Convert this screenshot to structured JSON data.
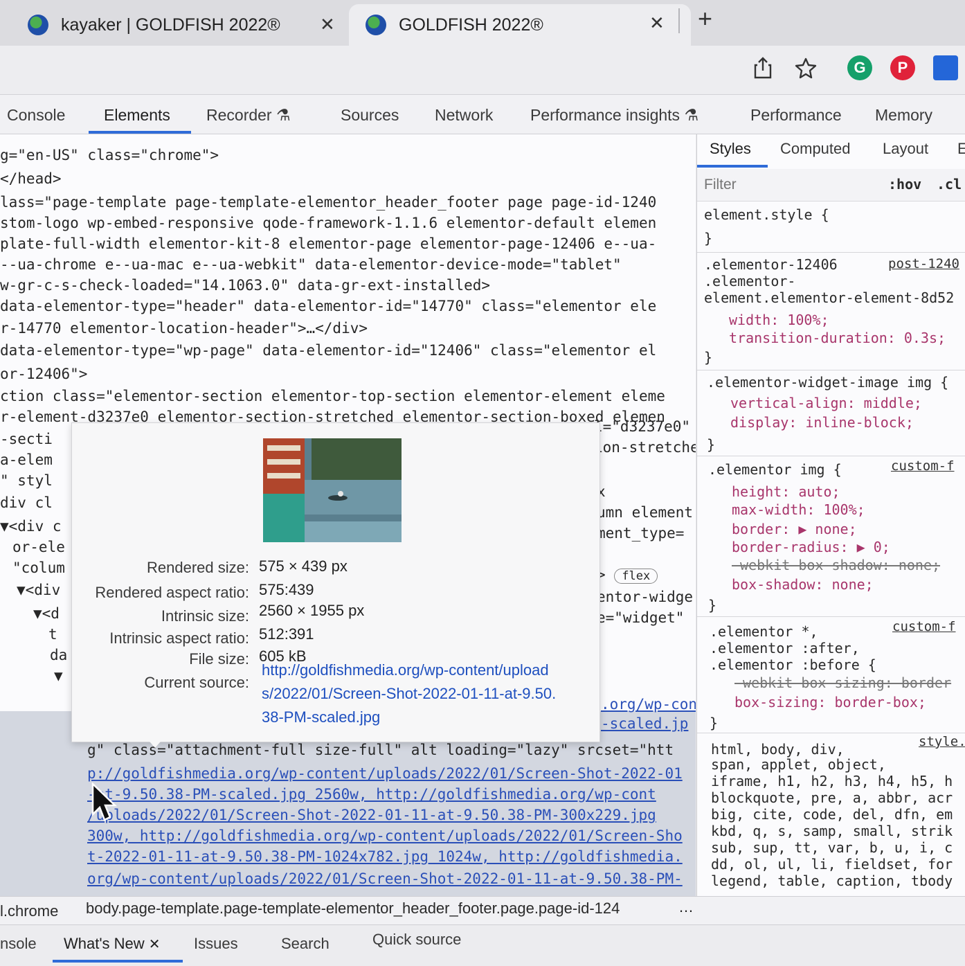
{
  "browser": {
    "tabs": [
      {
        "title": "kayaker | GOLDFISH 2022®",
        "close": "✕"
      },
      {
        "title": "GOLDFISH 2022®",
        "close": "✕"
      }
    ],
    "new_tab": "+"
  },
  "devtools": {
    "tabs": [
      "Console",
      "Elements",
      "Recorder",
      "Sources",
      "Network",
      "Performance insights",
      "Performance",
      "Memory"
    ],
    "dom_lines": [
      "g=\"en-US\" class=\"chrome\">",
      "</head>",
      "lass=\"page-template page-template-elementor_header_footer page page-id-1240",
      "stom-logo wp-embed-responsive qode-framework-1.1.6 elementor-default elemen",
      "plate-full-width elementor-kit-8 elementor-page elementor-page-12406 e--ua-",
      "--ua-chrome e--ua-mac e--ua-webkit\" data-elementor-device-mode=\"tablet\"",
      "w-gr-c-s-check-loaded=\"14.1063.0\" data-gr-ext-installed>",
      "data-elementor-type=\"header\" data-elementor-id=\"14770\" class=\"elementor ele",
      "r-14770 elementor-location-header\">…</div>",
      "data-elementor-type=\"wp-page\" data-elementor-id=\"12406\" class=\"elementor el",
      "or-12406\">",
      "ction class=\"elementor-section elementor-top-section elementor-element eleme",
      "r-element-d3237e0 elementor-section-stretched elementor-section-boxed elemen"
    ],
    "dom_left_frags": [
      "-secti",
      "a-elem",
      "\" styl",
      "div cl",
      "▼<div c",
      "or-ele",
      "\"colum",
      "▼<div",
      "▼<d",
      "t",
      "da",
      "▼"
    ],
    "dom_right_frags": [
      "l=\"d3237e0\"",
      "ion-stretche",
      "x",
      "umn element",
      "ment_type=",
      ">",
      "flex",
      "entor-widge",
      "e=\"widget\"",
      ".org/wp-con",
      "-scaled.jp"
    ],
    "sel_lines": [
      "g\" class=\"attachment-full size-full\" alt loading=\"lazy\" srcset=\"htt",
      "p://goldfishmedia.org/wp-content/uploads/2022/01/Screen-Shot-2022-01",
      "-at-9.50.38-PM-scaled.jpg 2560w, http://goldfishmedia.org/wp-cont",
      "/uploads/2022/01/Screen-Shot-2022-01-11-at-9.50.38-PM-300x229.jpg",
      "300w, http://goldfishmedia.org/wp-content/uploads/2022/01/Screen-Sho",
      "t-2022-01-11-at-9.50.38-PM-1024x782.jpg 1024w, http://goldfishmedia.",
      "org/wp-content/uploads/2022/01/Screen-Shot-2022-01-11-at-9.50.38-PM-"
    ],
    "breadcrumb": {
      "left": "l.chrome",
      "path": "body.page-template.page-template-elementor_header_footer.page.page-id-124",
      "more": "…"
    },
    "drawer_tabs": [
      "nsole",
      "What's New",
      "Issues",
      "Search",
      "Quick source"
    ],
    "drawer_close": "✕"
  },
  "styles": {
    "tabs": [
      "Styles",
      "Computed",
      "Layout",
      "E"
    ],
    "filter_placeholder": "Filter",
    "hov": ":hov",
    "cls": ".cl",
    "lines": [
      "element.style {",
      "}",
      ".elementor-12406",
      ".elementor-",
      "element.elementor-element-8d52",
      "width: 100%;",
      "transition-duration: 0.3s;",
      "}",
      ".elementor-widget-image img {",
      "vertical-align: middle;",
      "display: inline-block;",
      "}",
      ".elementor img {",
      "height: auto;",
      "max-width: 100%;",
      "border: ▶ none;",
      "border-radius: ▶ 0;",
      "-webkit-box-shadow: none;",
      "box-shadow: none;",
      "}",
      ".elementor *,",
      ".elementor :after,",
      ".elementor :before {",
      "-webkit-box-sizing: border",
      "box-sizing: border-box;",
      "}",
      "html, body, div,",
      "span, applet, object,",
      "iframe, h1, h2, h3, h4, h5, h",
      "blockquote, pre, a, abbr, acr",
      "big, cite, code, del, dfn, em",
      "kbd, q, s, samp, small, strik",
      "sub, sup, tt, var, b, u, i, c",
      "dd, ol, ul, li, fieldset, for",
      "legend, table, caption, tbody"
    ],
    "sources": [
      "post-1240",
      "custom-f",
      "custom-f",
      "style."
    ]
  },
  "tooltip": {
    "rows": [
      {
        "label": "Rendered size:",
        "value": "575 × 439 px"
      },
      {
        "label": "Rendered aspect ratio:",
        "value": "575:439"
      },
      {
        "label": "Intrinsic size:",
        "value": "2560 × 1955 px"
      },
      {
        "label": "Intrinsic aspect ratio:",
        "value": "512:391"
      },
      {
        "label": "File size:",
        "value": "605 kB"
      },
      {
        "label": "Current source:",
        "value": ""
      }
    ],
    "source_lines": [
      "http://goldfishmedia.org/wp-content/upload",
      "s/2022/01/Screen-Shot-2022-01-11-at-9.50.",
      "38-PM-scaled.jpg"
    ]
  },
  "colors": {
    "accent": "#2f6bd8",
    "link": "#1e4fbf",
    "css_property": "#a8356b"
  },
  "icons": [
    "globe-icon",
    "share-icon",
    "star-icon",
    "grammarly-icon",
    "pinterest-icon",
    "extension-icon",
    "recorder-flask-icon",
    "cursor-icon"
  ]
}
